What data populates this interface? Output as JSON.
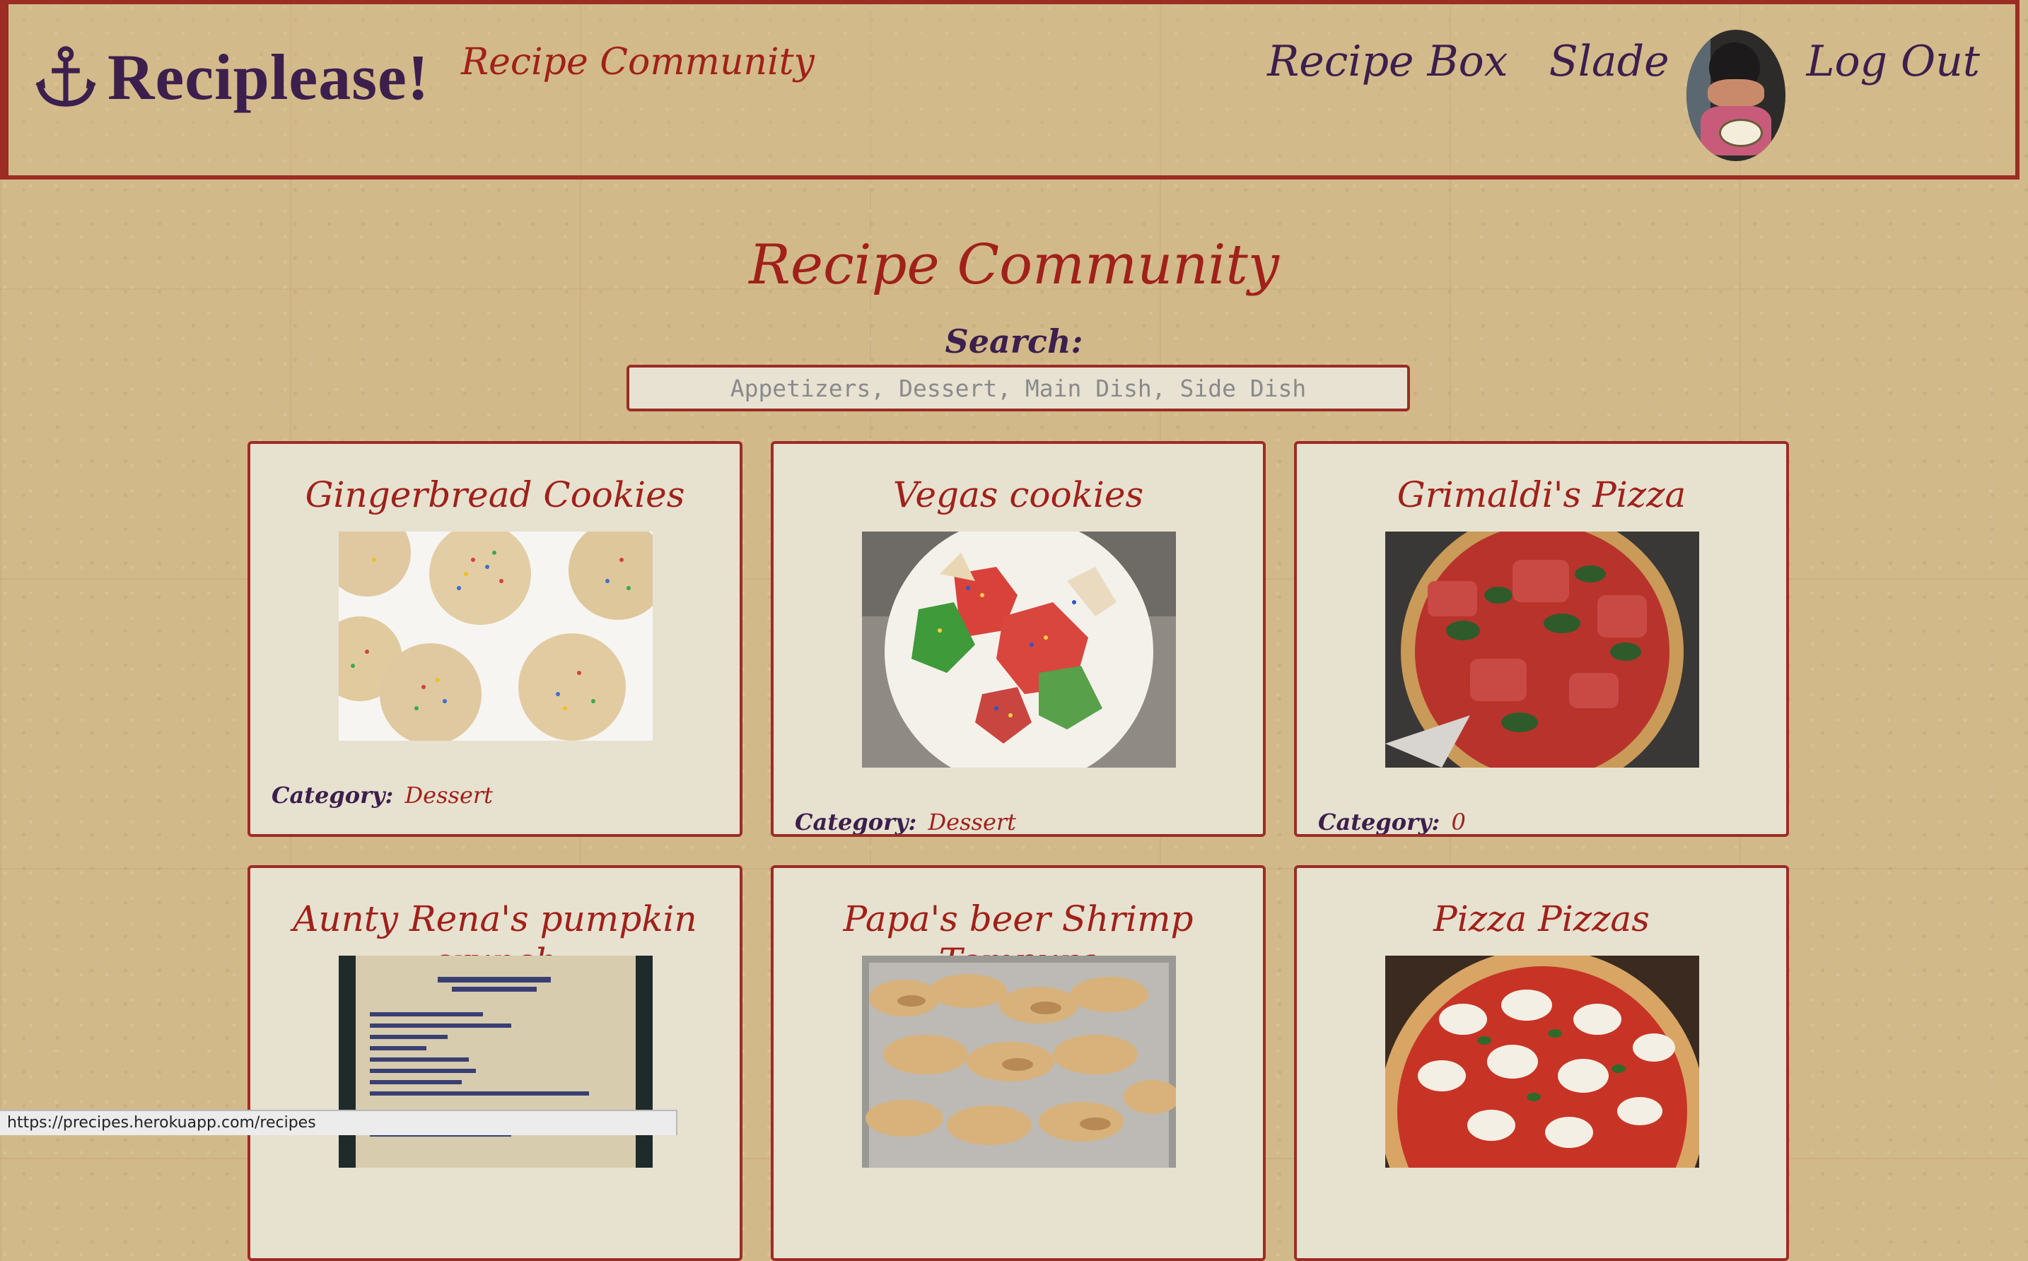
{
  "header": {
    "brand": "Reciplease!",
    "brand_icon": "anchor-icon",
    "nav_community": "Recipe Community",
    "nav_recipe_box": "Recipe Box",
    "nav_user": "Slade",
    "nav_logout": "Log Out"
  },
  "main": {
    "title": "Recipe Community",
    "search_label": "Search:",
    "search_placeholder": "Appetizers, Dessert, Main Dish, Side Dish"
  },
  "cards": [
    {
      "title": "Gingerbread Cookies",
      "category_label": "Category:",
      "category": "Dessert",
      "image": "sprinkle-cookies-photo"
    },
    {
      "title": "Vegas cookies",
      "category_label": "Category:",
      "category": "Dessert",
      "image": "decorated-cookies-photo"
    },
    {
      "title": "Grimaldi's Pizza",
      "category_label": "Category:",
      "category": "0",
      "image": "pizza-photo"
    },
    {
      "title": "Aunty Rena's pumpkin crunch",
      "image": "recipe-card-photo"
    },
    {
      "title": "Papa's beer Shrimp Tempura",
      "image": "shrimp-tempura-photo"
    },
    {
      "title": "Pizza Pizzas",
      "image": "margherita-pizza-photo"
    }
  ],
  "status_bar": {
    "url": "https://precipes.herokuapp.com/recipes"
  },
  "colors": {
    "accent": "#a0211a",
    "border": "#9b2d25",
    "brand": "#3c1f4d",
    "card_bg": "#e7e1d0"
  }
}
